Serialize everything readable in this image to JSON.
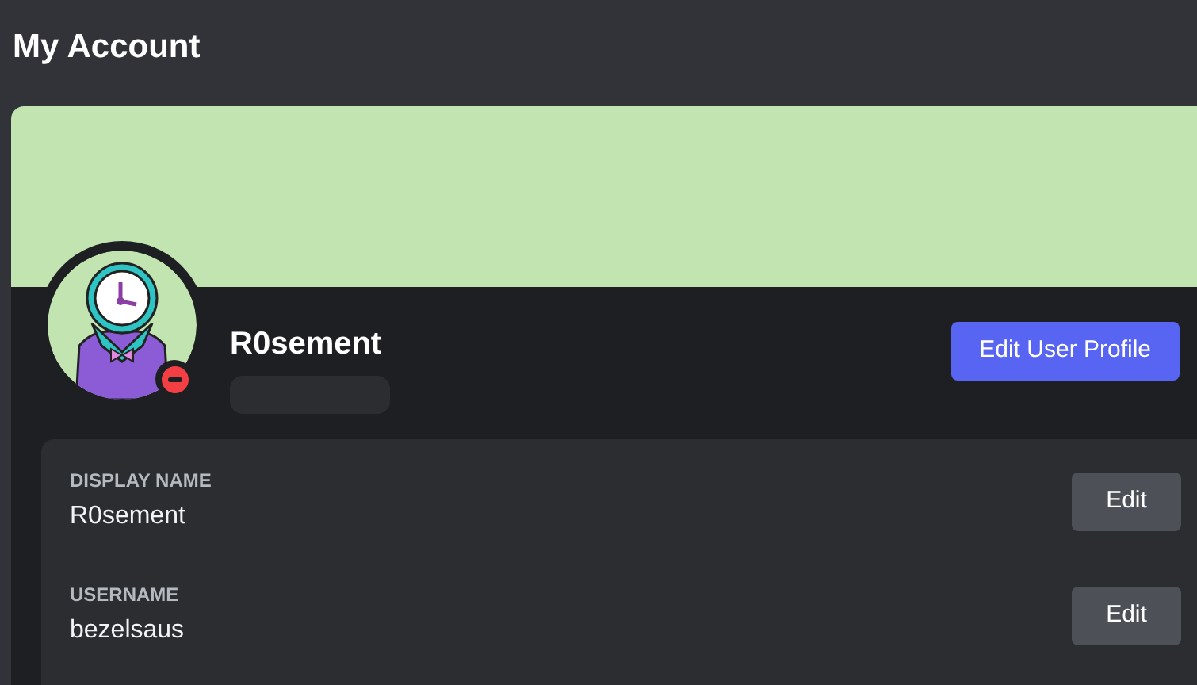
{
  "page_title": "My Account",
  "profile": {
    "name": "R0sement",
    "do_not_disturb": true,
    "edit_button": "Edit User Profile"
  },
  "fields": [
    {
      "label": "DISPLAY NAME",
      "value": "R0sement",
      "button": "Edit"
    },
    {
      "label": "USERNAME",
      "value": "bezelsaus",
      "button": "Edit"
    }
  ]
}
